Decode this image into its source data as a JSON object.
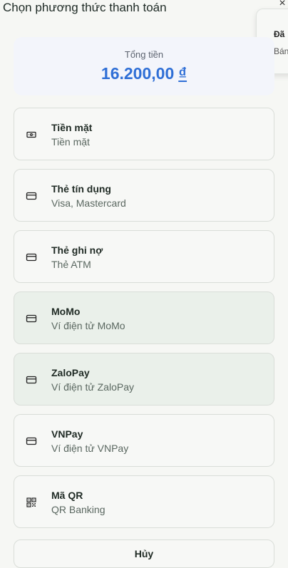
{
  "dialog": {
    "title": "Chọn phương thức thanh toán",
    "close_glyph": "×"
  },
  "toast": {
    "title": "Đã",
    "text": "Bán"
  },
  "total": {
    "label": "Tổng tiền",
    "amount": "16.200,00",
    "currency": "₫"
  },
  "methods": [
    {
      "name": "Tiền mặt",
      "desc": "Tiền mặt",
      "icon": "cash-icon"
    },
    {
      "name": "Thẻ tín dụng",
      "desc": "Visa, Mastercard",
      "icon": "credit-card-icon"
    },
    {
      "name": "Thẻ ghi nợ",
      "desc": "Thẻ ATM",
      "icon": "credit-card-icon"
    },
    {
      "name": "MoMo",
      "desc": "Ví điện tử MoMo",
      "icon": "credit-card-icon"
    },
    {
      "name": "ZaloPay",
      "desc": "Ví điện tử ZaloPay",
      "icon": "credit-card-icon"
    },
    {
      "name": "VNPay",
      "desc": "Ví điện tử VNPay",
      "icon": "credit-card-icon"
    },
    {
      "name": "Mã QR",
      "desc": "QR Banking",
      "icon": "qr-code-icon"
    }
  ],
  "cancel_label": "Hủy"
}
